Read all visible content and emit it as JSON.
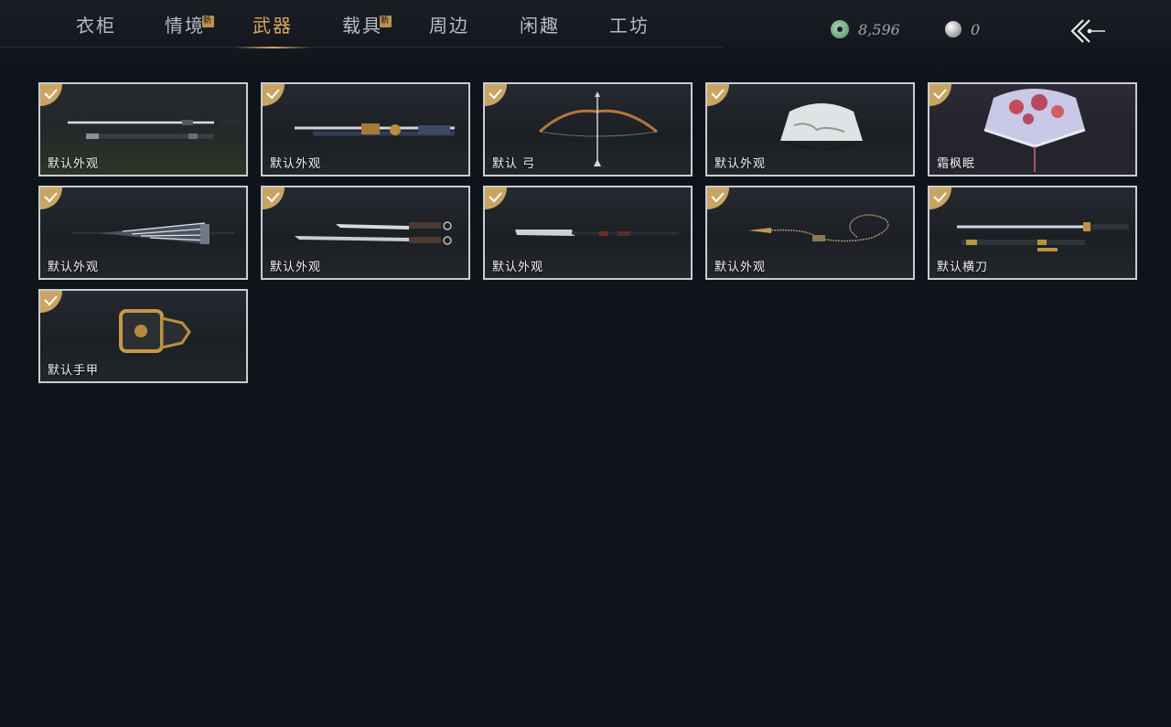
{
  "tabs": [
    {
      "label": "衣柜",
      "badge": ""
    },
    {
      "label": "情境",
      "badge": "新"
    },
    {
      "label": "武器",
      "badge": ""
    },
    {
      "label": "载具",
      "badge": "新"
    },
    {
      "label": "周边",
      "badge": ""
    },
    {
      "label": "闲趣",
      "badge": ""
    },
    {
      "label": "工坊",
      "badge": ""
    }
  ],
  "active_tab": "武器",
  "currency": {
    "jade": {
      "icon": "jade-coin-icon",
      "value": "8,596"
    },
    "pearl": {
      "icon": "pearl-icon",
      "value": "0"
    }
  },
  "back_icon": "back-arrow-icon",
  "items": [
    {
      "label": "默认外观",
      "art": "sword-icon",
      "owned": true
    },
    {
      "label": "默认外观",
      "art": "twin-swords-icon",
      "owned": true
    },
    {
      "label": "默认 弓",
      "art": "bow-icon",
      "owned": true
    },
    {
      "label": "默认外观",
      "art": "fan-icon",
      "owned": true
    },
    {
      "label": "霜枫眠",
      "art": "maple-fan-icon",
      "owned": true
    },
    {
      "label": "默认外观",
      "art": "umbrella-icon",
      "owned": true
    },
    {
      "label": "默认外观",
      "art": "dual-blades-icon",
      "owned": true
    },
    {
      "label": "默认外观",
      "art": "glaive-icon",
      "owned": true
    },
    {
      "label": "默认外观",
      "art": "rope-dart-icon",
      "owned": true
    },
    {
      "label": "默认横刀",
      "art": "hengdao-icon",
      "owned": true
    },
    {
      "label": "默认手甲",
      "art": "gauntlet-icon",
      "owned": true
    }
  ],
  "colors": {
    "accent": "#d9a760",
    "check": "#c9a462",
    "border": "#c9ccd1",
    "background": "#0f131a"
  }
}
